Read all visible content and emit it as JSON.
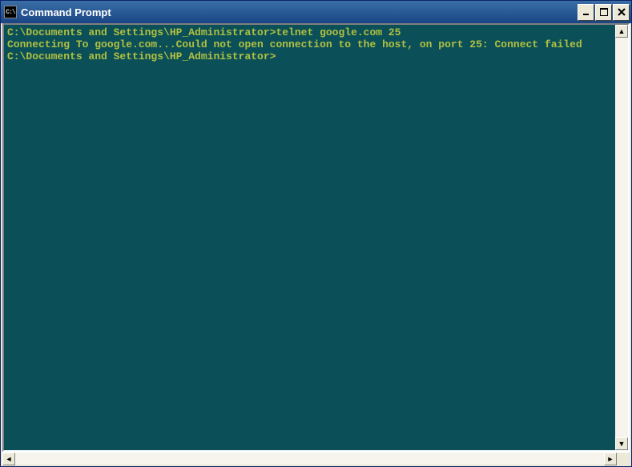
{
  "window": {
    "title": "Command Prompt",
    "icon_label": "C:\\"
  },
  "controls": {
    "minimize": "_",
    "maximize": "□",
    "close": "×"
  },
  "console": {
    "lines": [
      "C:\\Documents and Settings\\HP_Administrator>telnet google.com 25",
      "Connecting To google.com...Could not open connection to the host, on port 25: Connect failed",
      "",
      "C:\\Documents and Settings\\HP_Administrator>"
    ]
  },
  "scroll": {
    "up": "▲",
    "down": "▼",
    "left": "◄",
    "right": "►"
  }
}
